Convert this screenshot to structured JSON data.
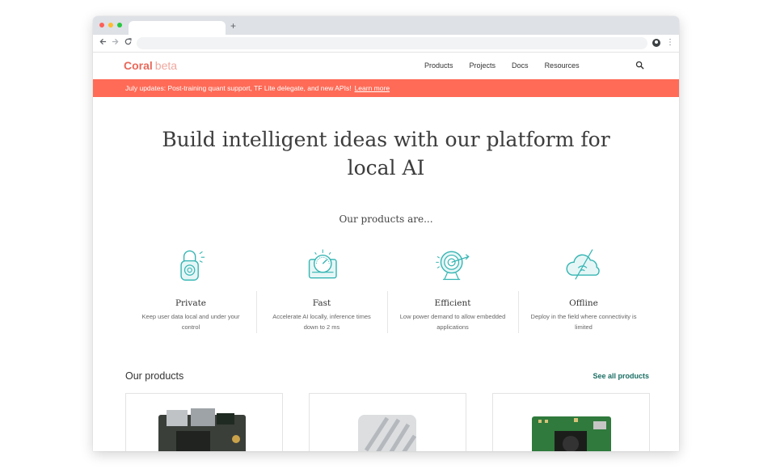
{
  "colors": {
    "accent": "#ff6b57",
    "teal": "#35b5b3",
    "link": "#1a6e63"
  },
  "browser": {
    "new_tab_label": "+",
    "back_icon": "arrow-left-icon",
    "forward_icon": "arrow-right-icon",
    "reload_icon": "reload-icon"
  },
  "nav": {
    "logo": "Coral",
    "logo_suffix": "beta",
    "items": [
      {
        "label": "Products"
      },
      {
        "label": "Projects"
      },
      {
        "label": "Docs"
      },
      {
        "label": "Resources"
      }
    ]
  },
  "banner": {
    "text": "July updates: Post-training quant support, TF Lite delegate, and new APIs!",
    "link": "Learn more"
  },
  "hero": {
    "line1": "Build intelligent ideas with our platform for",
    "line2": "local AI"
  },
  "products_intro": "Our products are...",
  "features": [
    {
      "icon": "padlock-icon",
      "title": "Private",
      "desc": "Keep user data local and under your control"
    },
    {
      "icon": "speedometer-icon",
      "title": "Fast",
      "desc": "Accelerate AI locally, inference times down to 2 ms"
    },
    {
      "icon": "target-icon",
      "title": "Efficient",
      "desc": "Low power demand to allow embedded applications"
    },
    {
      "icon": "cloud-offline-icon",
      "title": "Offline",
      "desc": "Deploy in the field where connectivity is limited"
    }
  ],
  "our_products": {
    "title": "Our products",
    "see_all": "See all products"
  }
}
